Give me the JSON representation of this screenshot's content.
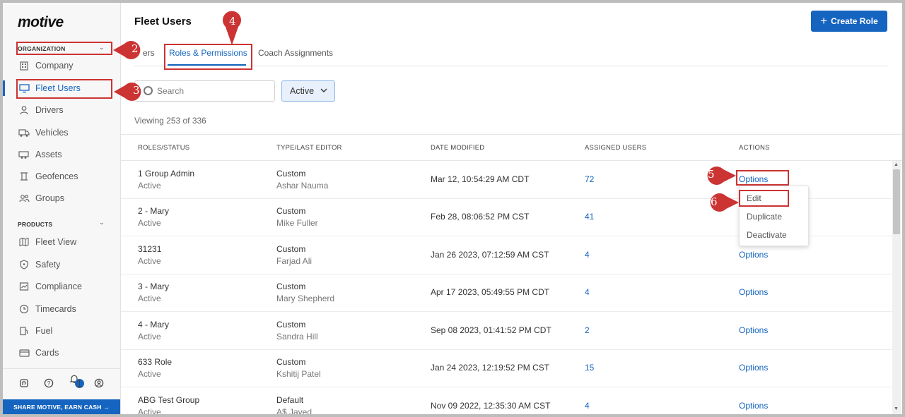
{
  "sidebar": {
    "logo": "motive",
    "org_label": "ORGANIZATION",
    "org_items": [
      {
        "label": "Company",
        "icon": "building-icon"
      },
      {
        "label": "Fleet Users",
        "icon": "monitor-icon"
      },
      {
        "label": "Drivers",
        "icon": "person-icon"
      },
      {
        "label": "Vehicles",
        "icon": "truck-icon"
      },
      {
        "label": "Assets",
        "icon": "trailer-icon"
      },
      {
        "label": "Geofences",
        "icon": "geofence-icon"
      },
      {
        "label": "Groups",
        "icon": "groups-icon"
      }
    ],
    "products_label": "PRODUCTS",
    "product_items": [
      {
        "label": "Fleet View",
        "icon": "map-icon"
      },
      {
        "label": "Safety",
        "icon": "shield-icon"
      },
      {
        "label": "Compliance",
        "icon": "compliance-icon"
      },
      {
        "label": "Timecards",
        "icon": "clock-icon"
      },
      {
        "label": "Fuel",
        "icon": "fuel-icon"
      },
      {
        "label": "Cards",
        "icon": "card-icon"
      }
    ],
    "notification_count": "1",
    "share_label": "SHARE MOTIVE, EARN CASH →"
  },
  "header": {
    "title": "Fleet Users",
    "create_label": "Create Role"
  },
  "tabs": [
    "ers",
    "Roles & Permissions",
    "Coach Assignments"
  ],
  "search": {
    "placeholder": "Search"
  },
  "filter": {
    "label": "Active"
  },
  "viewing": "Viewing 253 of 336",
  "table": {
    "headers": [
      "ROLES/STATUS",
      "TYPE/LAST EDITOR",
      "DATE MODIFIED",
      "ASSIGNED USERS",
      "ACTIONS"
    ],
    "rows": [
      {
        "role": "1 Group Admin",
        "status": "Active",
        "type": "Custom",
        "editor": "Ashar Nauma",
        "date": "Mar 12, 10:54:29 AM CDT",
        "users": "72",
        "action": "Options"
      },
      {
        "role": "2 - Mary",
        "status": "Active",
        "type": "Custom",
        "editor": "Mike Fuller",
        "date": "Feb 28, 08:06:52 PM CST",
        "users": "41",
        "action": "Options"
      },
      {
        "role": "31231",
        "status": "Active",
        "type": "Custom",
        "editor": "Farjad Ali",
        "date": "Jan 26 2023, 07:12:59 AM CST",
        "users": "4",
        "action": "Options"
      },
      {
        "role": "3 - Mary",
        "status": "Active",
        "type": "Custom",
        "editor": "Mary Shepherd",
        "date": "Apr 17 2023, 05:49:55 PM CDT",
        "users": "4",
        "action": "Options"
      },
      {
        "role": "4 - Mary",
        "status": "Active",
        "type": "Custom",
        "editor": "Sandra Hill",
        "date": "Sep 08 2023, 01:41:52 PM CDT",
        "users": "2",
        "action": "Options"
      },
      {
        "role": "633 Role",
        "status": "Active",
        "type": "Custom",
        "editor": "Kshitij Patel",
        "date": "Jan 24 2023, 12:19:52 PM CST",
        "users": "15",
        "action": "Options"
      },
      {
        "role": "ABG Test Group",
        "status": "Active",
        "type": "Default",
        "editor": "A$ Javed",
        "date": "Nov 09 2022, 12:35:30 AM CST",
        "users": "4",
        "action": "Options"
      }
    ]
  },
  "dropdown": [
    "Edit",
    "Duplicate",
    "Deactivate"
  ],
  "callouts": [
    "2",
    "3",
    "4",
    "5",
    "6"
  ],
  "colors": {
    "accent": "#1565c0",
    "annotation": "#cc3333"
  }
}
